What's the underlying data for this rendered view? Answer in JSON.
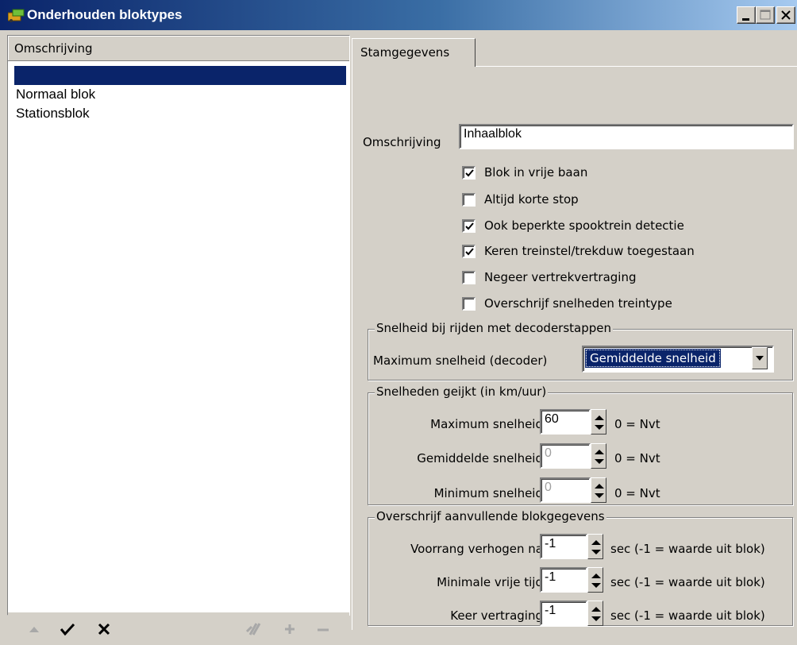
{
  "window": {
    "title": "Onderhouden bloktypes",
    "buttons": [
      "minimize",
      "maximize",
      "close"
    ]
  },
  "list": {
    "header": "Omschrijving",
    "items": [
      {
        "label": "",
        "selected": true
      },
      {
        "label": "Normaal blok",
        "selected": false
      },
      {
        "label": "Stationsblok",
        "selected": false
      }
    ],
    "toolbar": [
      "move-up-icon",
      "check-icon",
      "cross-icon",
      "copy-icon",
      "plus-icon",
      "minus-icon"
    ]
  },
  "tabs": [
    "Stamgegevens"
  ],
  "form": {
    "omschrijving_label": "Omschrijving",
    "omschrijving_value": "Inhaalblok",
    "checkboxes": [
      {
        "label": "Blok in vrije baan",
        "checked": true
      },
      {
        "label": "Altijd korte stop",
        "checked": false
      },
      {
        "label": "Ook beperkte spooktrein detectie",
        "checked": true
      },
      {
        "label": "Keren treinstel/trekduw toegestaan",
        "checked": true
      },
      {
        "label": "Negeer vertrekvertraging",
        "checked": false
      },
      {
        "label": "Overschrijf snelheden treintype",
        "checked": false
      }
    ],
    "decoder_group": {
      "title": "Snelheid bij rijden met decoderstappen",
      "label": "Maximum snelheid (decoder)",
      "value": "Gemiddelde snelheid"
    },
    "speed_group": {
      "title": "Snelheden geijkt (in km/uur)",
      "rows": [
        {
          "label": "Maximum snelheid",
          "value": "60",
          "enabled": true,
          "suffix": "0 = Nvt"
        },
        {
          "label": "Gemiddelde snelheid",
          "value": "0",
          "enabled": false,
          "suffix": "0 = Nvt"
        },
        {
          "label": "Minimum snelheid",
          "value": "0",
          "enabled": false,
          "suffix": "0 = Nvt"
        }
      ]
    },
    "extra_group": {
      "title": "Overschrijf aanvullende blokgegevens",
      "rows": [
        {
          "label": "Voorrang verhogen na",
          "value": "-1",
          "suffix": "sec (-1 = waarde uit blok)"
        },
        {
          "label": "Minimale vrije tijd",
          "value": "-1",
          "suffix": "sec (-1 = waarde uit blok)"
        },
        {
          "label": "Keer vertraging",
          "value": "-1",
          "suffix": "sec (-1 = waarde uit blok)"
        }
      ]
    }
  }
}
